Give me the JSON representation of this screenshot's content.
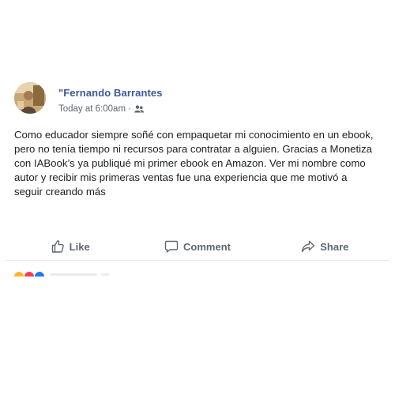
{
  "post": {
    "author": "\"Fernando Barrantes",
    "timestamp": "Today at 6:00am",
    "separator": "·",
    "audience_icon": "friends-icon",
    "text": "Como educador siempre soñé con empaquetar mi conocimiento en un ebook, pero no tenía tiempo ni recursos para contratar a alguien. Gracias a Monetiza con IABook’s ya publiqué mi primer ebook en Amazon. Ver mi nombre como autor y recibir mis primeras ventas fue una experiencia que me motivó a seguir creando más"
  },
  "actions": {
    "like_label": "Like",
    "comment_label": "Comment",
    "share_label": "Share"
  },
  "colors": {
    "author": "#3b5998",
    "meta": "#616770",
    "body": "#1c1e21",
    "action": "#606770",
    "divider": "#e4e6eb",
    "reaction_like": "#f7b928",
    "reaction_love": "#f33e58",
    "reaction_blue": "#2078f4"
  }
}
